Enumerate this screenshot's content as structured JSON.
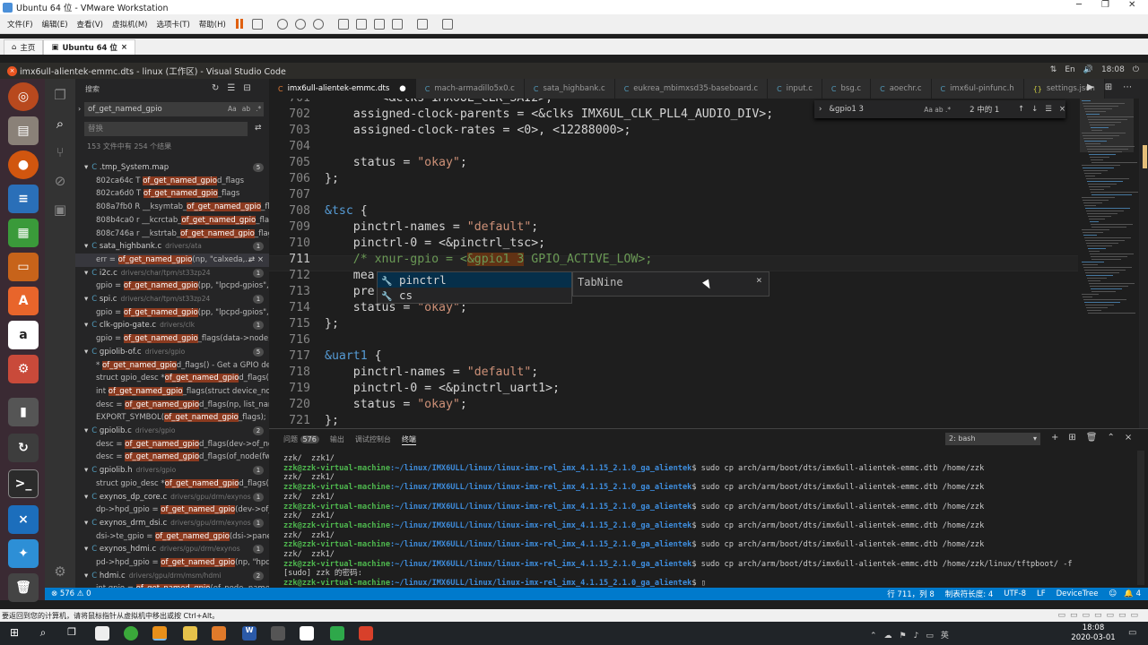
{
  "vmware": {
    "title": "Ubuntu 64 位 - VMware Workstation",
    "window_controls": [
      "─",
      "❐",
      "✕"
    ],
    "menu": [
      "文件(F)",
      "编辑(E)",
      "查看(V)",
      "虚拟机(M)",
      "选项卡(T)",
      "帮助(H)"
    ],
    "tabs": [
      {
        "label": "主页"
      },
      {
        "label": "Ubuntu 64 位"
      }
    ],
    "bottom_hint": "要返回到您的计算机，请将鼠标指针从虚拟机中移出或按 Ctrl+Alt。"
  },
  "ubuntu": {
    "window_title": "imx6ull-alientek-emmc.dts - linux (工作区) - Visual Studio Code",
    "time": "18:08",
    "tray": [
      "⇅",
      "En",
      "🔊"
    ]
  },
  "sidebar": {
    "header": "搜索",
    "search_value": "of_get_named_gpio",
    "replace_placeholder": "替换",
    "summary": "153 文件中有 254 个结果",
    "results": [
      {
        "type": "file",
        "name": ".tmp_System.map",
        "path": "",
        "count": "5"
      },
      {
        "type": "match",
        "pre": "802ca64c T ",
        "hl": "of_get_named_gpio",
        "post": "d_flags"
      },
      {
        "type": "match",
        "pre": "802ca6d0 T ",
        "hl": "of_get_named_gpio",
        "post": "_flags"
      },
      {
        "type": "match",
        "pre": "808a7fb0 R __ksymtab_",
        "hl": "of_get_named_gpio",
        "post": "_flags"
      },
      {
        "type": "match",
        "pre": "808b4ca0 r __kcrctab_",
        "hl": "of_get_named_gpio",
        "post": "_flags"
      },
      {
        "type": "match",
        "pre": "808c746a r __kstrtab_",
        "hl": "of_get_named_gpio",
        "post": "_flags"
      },
      {
        "type": "file",
        "name": "sata_highbank.c",
        "path": "drivers/ata",
        "count": "1"
      },
      {
        "type": "match",
        "pre": "err = ",
        "hl": "of_get_named_gpio",
        "post": "(np, \"calxeda,...",
        "selected": true
      },
      {
        "type": "file",
        "name": "i2c.c",
        "path": "drivers/char/tpm/st33zp24",
        "count": "1"
      },
      {
        "type": "match",
        "pre": "gpio = ",
        "hl": "of_get_named_gpio",
        "post": "(pp, \"lpcpd-gpios\", 0);"
      },
      {
        "type": "file",
        "name": "spi.c",
        "path": "drivers/char/tpm/st33zp24",
        "count": "1"
      },
      {
        "type": "match",
        "pre": "gpio = ",
        "hl": "of_get_named_gpio",
        "post": "(pp, \"lpcpd-gpios\", 0);"
      },
      {
        "type": "file",
        "name": "clk-gpio-gate.c",
        "path": "drivers/clk",
        "count": "1"
      },
      {
        "type": "match",
        "pre": "gpio = ",
        "hl": "of_get_named_gpio",
        "post": "_flags(data->node, \"..."
      },
      {
        "type": "file",
        "name": "gpiolib-of.c",
        "path": "drivers/gpio",
        "count": "5"
      },
      {
        "type": "match",
        "pre": "* ",
        "hl": "of_get_named_gpio",
        "post": "d_flags() - Get a GPIO des..."
      },
      {
        "type": "match",
        "pre": "struct gpio_desc *",
        "hl": "of_get_named_gpio",
        "post": "d_flags(s..."
      },
      {
        "type": "match",
        "pre": "int ",
        "hl": "of_get_named_gpio",
        "post": "_flags(struct device_no..."
      },
      {
        "type": "match",
        "pre": "desc = ",
        "hl": "of_get_named_gpio",
        "post": "d_flags(np, list_nam..."
      },
      {
        "type": "match",
        "pre": "EXPORT_SYMBOL(",
        "hl": "of_get_named_gpio",
        "post": "_flags);"
      },
      {
        "type": "file",
        "name": "gpiolib.c",
        "path": "drivers/gpio",
        "count": "2"
      },
      {
        "type": "match",
        "pre": "desc = ",
        "hl": "of_get_named_gpio",
        "post": "d_flags(dev->of_nod..."
      },
      {
        "type": "match",
        "pre": "desc = ",
        "hl": "of_get_named_gpio",
        "post": "d_flags(of_node(fw..."
      },
      {
        "type": "file",
        "name": "gpiolib.h",
        "path": "drivers/gpio",
        "count": "1"
      },
      {
        "type": "match",
        "pre": "struct gpio_desc *",
        "hl": "of_get_named_gpio",
        "post": "d_flags(s..."
      },
      {
        "type": "file",
        "name": "exynos_dp_core.c",
        "path": "drivers/gpu/drm/exynos",
        "count": "1"
      },
      {
        "type": "match",
        "pre": "dp->hpd_gpio = ",
        "hl": "of_get_named_gpio",
        "post": "(dev->of_n..."
      },
      {
        "type": "file",
        "name": "exynos_drm_dsi.c",
        "path": "drivers/gpu/drm/exynos",
        "count": "1"
      },
      {
        "type": "match",
        "pre": "dsi->te_gpio = ",
        "hl": "of_get_named_gpio",
        "post": "(dsi->panel_..."
      },
      {
        "type": "file",
        "name": "exynos_hdmi.c",
        "path": "drivers/gpu/drm/exynos",
        "count": "1"
      },
      {
        "type": "match",
        "pre": "pd->hpd_gpio = ",
        "hl": "of_get_named_gpio",
        "post": "(np, \"hpd-g..."
      },
      {
        "type": "file",
        "name": "hdmi.c",
        "path": "drivers/gpu/drm/msm/hdmi",
        "count": "2"
      },
      {
        "type": "match",
        "pre": "int gpio = ",
        "hl": "of_get_named_gpio",
        "post": "(of_node, name, 0);"
      }
    ]
  },
  "editor": {
    "tabs": [
      {
        "label": "imx6ull-alientek-emmc.dts",
        "active": true,
        "dirty": "●"
      },
      {
        "label": "mach-armadillo5x0.c"
      },
      {
        "label": "sata_highbank.c"
      },
      {
        "label": "eukrea_mbimxsd35-baseboard.c"
      },
      {
        "label": "input.c"
      },
      {
        "label": "bsg.c"
      },
      {
        "label": "aoechr.c"
      },
      {
        "label": "imx6ul-pinfunc.h"
      },
      {
        "label": "settings.json"
      }
    ],
    "find": {
      "value": "&gpio1 3",
      "result": "2 中的 1"
    },
    "lines": [
      {
        "n": "701",
        "html": "        <&clks IMX6UL_CLK_SAI2>;"
      },
      {
        "n": "702",
        "html": "    assigned-clock-parents = <&clks IMX6UL_CLK_PLL4_AUDIO_DIV>;"
      },
      {
        "n": "703",
        "html": "    assigned-clock-rates = <0>, <12288000>;"
      },
      {
        "n": "704",
        "html": ""
      },
      {
        "n": "705",
        "html": "    status = \"okay\";"
      },
      {
        "n": "706",
        "html": "};"
      },
      {
        "n": "707",
        "html": ""
      },
      {
        "n": "708",
        "html": "&tsc {"
      },
      {
        "n": "709",
        "html": "    pinctrl-names = \"default\";"
      },
      {
        "n": "710",
        "html": "    pinctrl-0 = <&pinctrl_tsc>;"
      },
      {
        "n": "711",
        "html": "    /* xnur-gpio = <&gpio1 3 GPIO_ACTIVE_LOW>;"
      },
      {
        "n": "712",
        "html": "    mea"
      },
      {
        "n": "713",
        "html": "    pre"
      },
      {
        "n": "714",
        "html": "    status = \"okay\";"
      },
      {
        "n": "715",
        "html": "};"
      },
      {
        "n": "716",
        "html": ""
      },
      {
        "n": "717",
        "html": "&uart1 {"
      },
      {
        "n": "718",
        "html": "    pinctrl-names = \"default\";"
      },
      {
        "n": "719",
        "html": "    pinctrl-0 = <&pinctrl_uart1>;"
      },
      {
        "n": "720",
        "html": "    status = \"okay\";"
      },
      {
        "n": "721",
        "html": "};"
      }
    ],
    "suggestions": [
      "pinctrl",
      "cs"
    ],
    "tabnine_label": "TabNine"
  },
  "panel": {
    "tabs": [
      "问题",
      "输出",
      "调试控制台",
      "终端"
    ],
    "problems_count": "576",
    "terminal_select": "2: bash",
    "user_host": "zzk@zzk-virtual-machine",
    "cwd": ":~/linux/IMX6ULL/linux/linux-imx-rel_imx_4.1.15_2.1.0_ga_alientek",
    "cmd": "$ sudo cp arch/arm/boot/dts/imx6ull-alientek-emmc.dtb /home/zzk",
    "last_cmd": "$ sudo cp arch/arm/boot/dts/imx6ull-alientek-emmc.dtb /home/zzk/linux/tftpboot/ -f",
    "lines": [
      "zzk/  zzk1/",
      "PROMPT",
      "zzk/  zzk1/",
      "PROMPT",
      "zzk/  zzk1/",
      "PROMPT",
      "zzk/  zzk1/",
      "PROMPT",
      "zzk/  zzk1/",
      "PROMPT",
      "zzk/  zzk1/",
      "PROMPT_LAST",
      "[sudo] zzk 的密码:",
      "PROMPT_EMPTY"
    ]
  },
  "statusbar": {
    "left": "⊗ 576  ⚠ 0",
    "position": "行 711，列 8",
    "tabsize": "制表符长度: 4",
    "encoding": "UTF-8",
    "eol": "LF",
    "language": "DeviceTree",
    "feedback": "☺",
    "bell": "🔔 4"
  },
  "taskbar": {
    "time": "18:08",
    "date": "2020-03-01"
  },
  "colors": {
    "accent": "#007acc",
    "ubuntu_orange": "#e95420",
    "highlight": "#8b3a1f"
  }
}
